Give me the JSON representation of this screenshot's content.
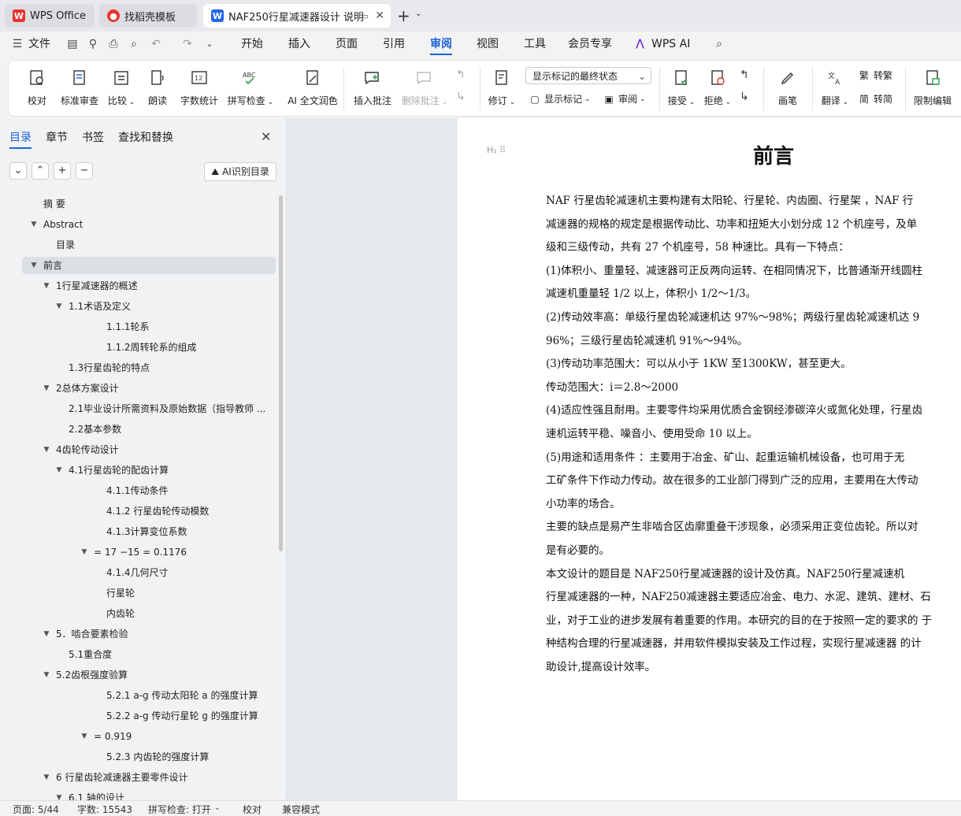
{
  "tabs": [
    {
      "label": "WPS Office",
      "icon": "wps-logo-icon"
    },
    {
      "label": "找稻壳模板",
      "icon": "docer-icon"
    },
    {
      "label": "NAF250行星减速器设计 说明",
      "icon": "word-doc-icon"
    }
  ],
  "menu": {
    "file": "文件",
    "items": [
      "开始",
      "插入",
      "页面",
      "引用",
      "审阅",
      "视图",
      "工具",
      "会员专享",
      "WPS AI"
    ],
    "active": "审阅"
  },
  "ribbon": {
    "buttons": [
      "校对",
      "标准审查",
      "比较",
      "朗读",
      "字数统计",
      "拼写检查",
      "AI 全文润色",
      "插入批注",
      "删除批注",
      "修订",
      "接受",
      "拒绝",
      "画笔",
      "限制编辑"
    ],
    "dropdown_value": "显示标记的最终状态",
    "show_markup": "显示标记",
    "review": "审阅",
    "fanzhuan": "翻译",
    "to_trad": "转繁",
    "to_simp": "转简"
  },
  "nav": {
    "tabs": [
      "目录",
      "章节",
      "书签",
      "查找和替换"
    ],
    "ai_button": "AI识别目录",
    "toc": [
      {
        "text": "摘  要",
        "level": 0,
        "arrow": false
      },
      {
        "text": "Abstract",
        "level": 0,
        "arrow": true
      },
      {
        "text": "目录",
        "level": 1,
        "arrow": false
      },
      {
        "text": "前言",
        "level": 0,
        "arrow": true,
        "selected": true
      },
      {
        "text": "1行星减速器的概述",
        "level": 1,
        "arrow": true
      },
      {
        "text": "1.1术语及定义",
        "level": 2,
        "arrow": true
      },
      {
        "text": "1.1.1轮系",
        "level": 4,
        "arrow": false
      },
      {
        "text": "1.1.2周转轮系的组成",
        "level": 4,
        "arrow": false
      },
      {
        "text": "1.3行星齿轮的特点",
        "level": 2,
        "arrow": false
      },
      {
        "text": "2总体方案设计",
        "level": 1,
        "arrow": true
      },
      {
        "text": "2.1毕业设计所需资料及原始数据（指导教师 ...",
        "level": 2,
        "arrow": false
      },
      {
        "text": "2.2基本参数",
        "level": 2,
        "arrow": false
      },
      {
        "text": "4齿轮传动设计",
        "level": 1,
        "arrow": true
      },
      {
        "text": "4.1行星齿轮的配齿计算",
        "level": 2,
        "arrow": true
      },
      {
        "text": "4.1.1传动条件",
        "level": 4,
        "arrow": false
      },
      {
        "text": "4.1.2 行星齿轮传动模数",
        "level": 4,
        "arrow": false
      },
      {
        "text": "4.1.3计算变位系数",
        "level": 4,
        "arrow": false
      },
      {
        "text": "= 17 −15 = 0.1176",
        "level": 3,
        "arrow": true
      },
      {
        "text": "4.1.4几何尺寸",
        "level": 4,
        "arrow": false
      },
      {
        "text": "行星轮",
        "level": 4,
        "arrow": false
      },
      {
        "text": "内齿轮",
        "level": 4,
        "arrow": false
      },
      {
        "text": "5．啮合要素检验",
        "level": 1,
        "arrow": true
      },
      {
        "text": "5.1重合度",
        "level": 2,
        "arrow": false
      },
      {
        "text": "5.2齿根强度验算",
        "level": 1,
        "arrow": true
      },
      {
        "text": "5.2.1 a-g 传动太阳轮 a 的强度计算",
        "level": 4,
        "arrow": false
      },
      {
        "text": "5.2.2 a-g 传动行星轮 g 的强度计算",
        "level": 4,
        "arrow": false
      },
      {
        "text": "= 0.919",
        "level": 3,
        "arrow": true
      },
      {
        "text": "5.2.3 内齿轮的强度计算",
        "level": 4,
        "arrow": false
      },
      {
        "text": "6 行星齿轮减速器主要零件设计",
        "level": 1,
        "arrow": true
      },
      {
        "text": "6.1  轴的设计",
        "level": 2,
        "arrow": true
      }
    ]
  },
  "document": {
    "title": "前言",
    "lines": [
      "      NAF 行星齿轮减速机主要构建有太阳轮、行星轮、内齿圈、行星架 ，NAF 行",
      "减速器的规格的规定是根据传动比、功率和扭矩大小划分成 12 个机座号，及单",
      "级和三级传动，共有 27 个机座号，58 种速比。具有一下特点：",
      " (1)体积小、重量轻、减速器可正反两向运转、在相同情况下，比普通渐开线圆柱",
      "减速机重量轻 1/2 以上，体积小 1/2～1/3。",
      " (2)传动效率高：单级行星齿轮减速机达 97%～98%；两级行星齿轮减速机达 9",
      "96%；三级行星齿轮减速机 91%～94%。",
      " (3)传动功率范围大：可以从小于 1KW 至1300KW，甚至更大。",
      "传动范围大：i＝2.8～2000",
      " (4)适应性强且耐用。主要零件均采用优质合金钢经渗碳淬火或氮化处理，行星齿",
      "速机运转平稳、噪音小、使用受命 10 以上。",
      " (5)用途和适用条件  ：主要用于冶金、矿山、起重运输机械设备，也可用于无",
      "工矿条件下作动力传动。故在很多的工业部门得到广泛的应用，主要用在大传动",
      "小功率的场合。",
      "主要的缺点是易产生非啮合区齿廓重叠干涉现象，必须采用正变位齿轮。所以对",
      "是有必要的。",
      "      本文设计的题目是 NAF250行星减速器的设计及仿真。NAF250行星减速机",
      "行星减速器的一种，NAF250减速器主要适应冶金、电力、水泥、建筑、建材、石",
      "业，对于工业的进步发展有着重要的作用。本研究的目的在于按照一定的要求的 于",
      "种结构合理的行星减速器，并用软件模拟安装及工作过程，实现行星减速器 的计",
      "助设计,提高设计效率。"
    ]
  },
  "status": {
    "page": "页面: 5/44",
    "words": "字数: 15543",
    "spell": "拼写检查: 打开",
    "proof": "校对",
    "compat": "兼容模式"
  }
}
